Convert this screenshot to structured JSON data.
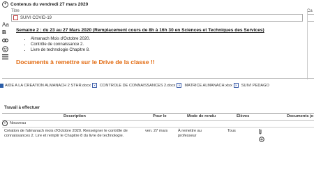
{
  "header": {
    "title": "Contenus du vendredi 27 mars 2020"
  },
  "form": {
    "title_label": "Titre",
    "right_label": "Ca",
    "title_value": "SUIVI COVID-19"
  },
  "content": {
    "heading": "Semaine 2 : du 23 au 27 Mars 2020 (Remplacement cours de 8h à 16h 30 en Sciences et Techniques des Services)",
    "items": [
      "Almanach Mois d'Octobre 2020.",
      "Contrôle de connaissance 2.",
      "Livre de technologie Chapitre 8."
    ],
    "notice": "Documents à remettre sur le Drive de la classe !!"
  },
  "attachments": [
    "AIDE A LA CREATION ALMANACH 2 STHR.docx",
    "CONTROLE DE CONNAISSANCES 2.docx",
    "MATRICE ALMANACH.xlsx",
    "SUIVI PEDAGO"
  ],
  "work": {
    "title": "Travail à effectuer",
    "columns": {
      "description": "Description",
      "date": "Pour le",
      "mode": "Mode de rendu",
      "students": "Élèves",
      "docs": "Documents jo"
    },
    "new_label": "Nouveau",
    "row": {
      "description": "Création de l'almanach mois d'Octobre 2020. Renseigner le contrôle de connaissances 2. Lire et remplir le Chapitre 8 du livre de technologie.",
      "date": "ven. 27 mars",
      "mode": "À remettre au professeur",
      "students": "Tous"
    }
  },
  "icons": {
    "add": "plus-circle-icon",
    "font": "font-size-icon",
    "bold": "bold-icon",
    "link": "link-icon",
    "list": "list-icon",
    "attach": "paperclip-icon",
    "cloud": "cloud-icon"
  },
  "colors": {
    "notice": "#e26a10",
    "attach_doc": "#2a5da8"
  }
}
